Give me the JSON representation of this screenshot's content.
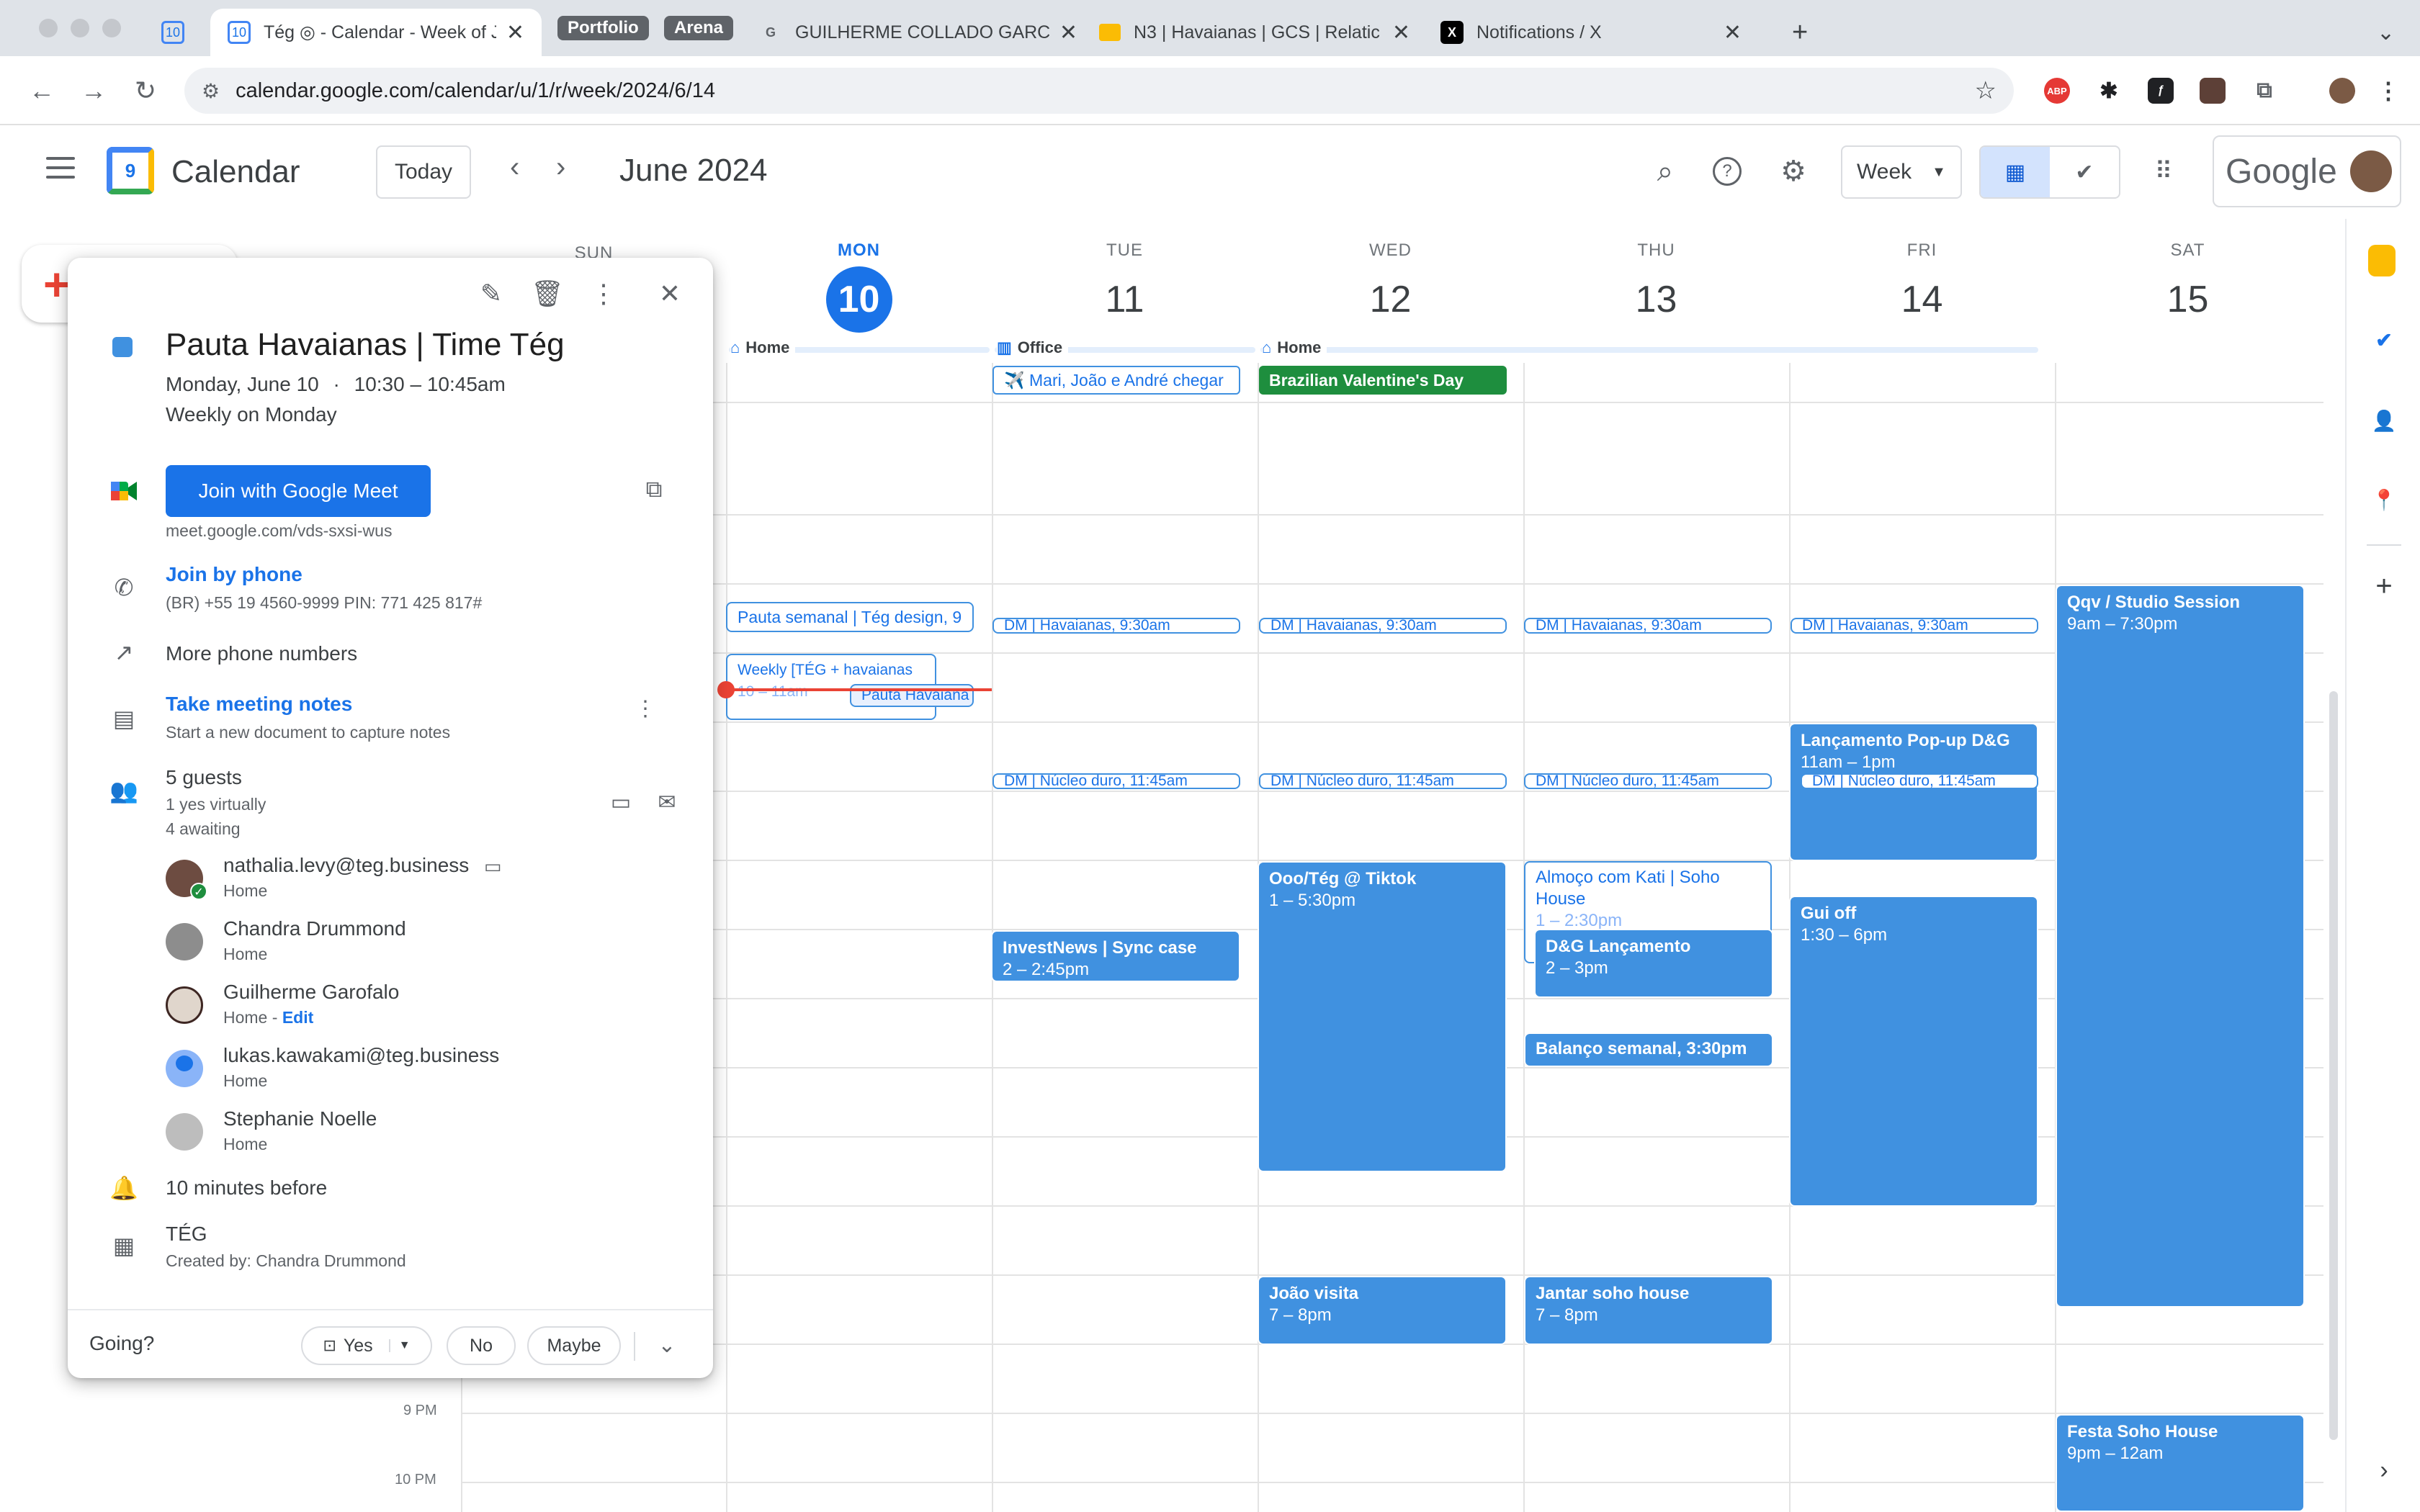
{
  "browser": {
    "tabs": [
      {
        "title": "",
        "favicon": "calendar-favicon-10"
      },
      {
        "title": "Tég ◎ - Calendar - Week of J",
        "favicon": "calendar-favicon-10",
        "active": true
      },
      {
        "title": "Portfolio",
        "kind": "group"
      },
      {
        "title": "Arena",
        "kind": "group"
      },
      {
        "title": "GUILHERME COLLADO GARC",
        "favicon": "google-g-icon"
      },
      {
        "title": "N3 | Havaianas | GCS | Relatic",
        "favicon": "slides-icon"
      },
      {
        "title": "Notifications / X",
        "favicon": "x-logo-icon"
      }
    ],
    "new_tab": "+",
    "url": "calendar.google.com/calendar/u/1/r/week/2024/6/14",
    "extensions": [
      "ABP"
    ]
  },
  "header": {
    "app_name": "Calendar",
    "logo_day": "9",
    "today_label": "Today",
    "month_title": "June 2024",
    "view_label": "Week",
    "google_word": "Google"
  },
  "week": {
    "days": [
      {
        "dow": "SUN",
        "num": ""
      },
      {
        "dow": "MON",
        "num": "10",
        "today": true
      },
      {
        "dow": "TUE",
        "num": "11"
      },
      {
        "dow": "WED",
        "num": "12"
      },
      {
        "dow": "THU",
        "num": "13"
      },
      {
        "dow": "FRI",
        "num": "14"
      },
      {
        "dow": "SAT",
        "num": "15"
      }
    ],
    "working_locations": [
      {
        "day": "MON",
        "label": "Home",
        "icon": "home-icon"
      },
      {
        "day": "TUE",
        "label": "Office",
        "icon": "office-icon"
      },
      {
        "day": "WED",
        "label": "Home",
        "icon": "home-icon"
      }
    ],
    "all_day": [
      {
        "day": "TUE",
        "title": "✈️ Mari, João e André chegar"
      },
      {
        "day": "WED",
        "title": "Brazilian Valentine's Day",
        "color": "#1e8e3e"
      }
    ],
    "time_labels": [
      "9 PM",
      "10 PM"
    ],
    "events": {
      "mon_pauta": "Pauta semanal | Tég design, 9",
      "mon_weekly": "Weekly [TÉG + havaianas",
      "mon_weekly_time": "10 – 11am",
      "mon_pauta_hav": "Pauta Havaiana",
      "dm_havaianas": "DM | Havaianas, 9:30am",
      "dm_nucleo": "DM | Núcleo duro, 11:45am",
      "sat_qqv": "Qqv / Studio Session",
      "sat_qqv_time": "9am – 7:30pm",
      "fri_lanc": "Lançamento Pop-up D&G",
      "fri_lanc_time": "11am – 1pm",
      "wed_ooo": "Ooo/Tég @ Tiktok",
      "wed_ooo_time": "1 – 5:30pm",
      "thu_almoco": "Almoço com Kati | Soho House",
      "thu_almoco_time": "1 – 2:30pm",
      "thu_dg": "D&G Lançamento",
      "thu_dg_time": "2 – 3pm",
      "tue_investnews": "InvestNews | Sync case",
      "tue_investnews_time": "2 – 2:45pm",
      "fri_gui": "Gui off",
      "fri_gui_time": "1:30 – 6pm",
      "thu_balanco": "Balanço semanal, 3:30pm",
      "wed_joao": "João visita",
      "wed_joao_time": "7 – 8pm",
      "thu_jantar": "Jantar soho house",
      "thu_jantar_time": "7 – 8pm",
      "sat_festa": "Festa Soho House",
      "sat_festa_time": "9pm – 12am"
    }
  },
  "popover": {
    "title": "Pauta Havaianas | Time Tég",
    "date": "Monday, June 10",
    "dot": "·",
    "time": "10:30 – 10:45am",
    "recurrence": "Weekly on Monday",
    "meet_button": "Join with Google Meet",
    "meet_link": "meet.google.com/vds-sxsi-wus",
    "phone_link": "Join by phone",
    "phone_detail": "(BR) +55 19 4560-9999 PIN: 771 425 817#",
    "more_numbers": "More phone numbers",
    "notes_link": "Take meeting notes",
    "notes_detail": "Start a new document to capture notes",
    "guests_count": "5 guests",
    "guests_yes": "1 yes virtually",
    "guests_awaiting": "4 awaiting",
    "guests": [
      {
        "name": "nathalia.levy@teg.business",
        "location": "Home"
      },
      {
        "name": "Chandra Drummond",
        "location": "Home"
      },
      {
        "name": "Guilherme Garofalo",
        "location": "Home",
        "edit": "Edit"
      },
      {
        "name": "lukas.kawakami@teg.business",
        "location": "Home"
      },
      {
        "name": "Stephanie Noelle",
        "location": "Home"
      }
    ],
    "reminder": "10 minutes before",
    "calendar": "TÉG",
    "created_by": "Created by: Chandra Drummond",
    "going_label": "Going?",
    "rsvp_yes": "Yes",
    "rsvp_no": "No",
    "rsvp_maybe": "Maybe"
  }
}
